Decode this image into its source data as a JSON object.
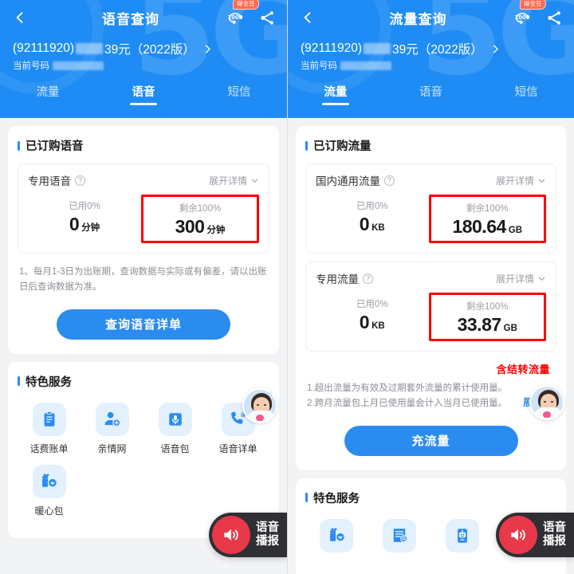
{
  "screens": [
    {
      "header": {
        "back_icon": "chevron-left-icon",
        "title": "语音查询",
        "coin_icon": "coin-1000-icon",
        "coin_badge": "得全豆",
        "share_icon": "share-icon",
        "watermark": "5G",
        "plan_id": "(92111920)",
        "plan_name": "39元（2022版）",
        "plan_chevron": "chevron-right-icon",
        "current_number_label": "当前号码",
        "tabs": [
          {
            "label": "流量",
            "active": false
          },
          {
            "label": "语音",
            "active": true
          },
          {
            "label": "短信",
            "active": false
          }
        ]
      },
      "subscribed": {
        "title": "已订购语音",
        "packages": [
          {
            "name": "专用语音",
            "help_icon": "question-circle-icon",
            "expand_label": "展开详情",
            "expand_icon": "chevron-down-icon",
            "used_label": "已用0%",
            "used_value": "0",
            "used_unit": "分钟",
            "left_label": "剩余100%",
            "left_value": "300",
            "left_unit": "分钟",
            "highlight": true
          }
        ],
        "notes": [
          "1、每月1-3日为出账期，查询数据与实际或有偏差，请以出账日后查询数据为准。"
        ],
        "cta": "查询语音详单"
      },
      "services": {
        "title": "特色服务",
        "items": [
          {
            "label": "话费账单",
            "icon": "clipboard-bill-icon"
          },
          {
            "label": "亲情网",
            "icon": "user-add-icon"
          },
          {
            "label": "语音包",
            "icon": "microphone-icon"
          },
          {
            "label": "语音详单",
            "icon": "phone-detail-icon"
          },
          {
            "label": "暖心包",
            "icon": "gift-heart-icon"
          }
        ]
      },
      "avatar": {
        "icon": "assistant-avatar"
      },
      "voice_fab": {
        "icon": "speaker-icon",
        "line1": "语音",
        "line2": "播报"
      }
    },
    {
      "header": {
        "back_icon": "chevron-left-icon",
        "title": "流量查询",
        "coin_icon": "coin-1000-icon",
        "coin_badge": "得全豆",
        "share_icon": "share-icon",
        "watermark": "5G",
        "plan_id": "(92111920)",
        "plan_name": "39元（2022版）",
        "plan_chevron": "chevron-right-icon",
        "current_number_label": "当前号码",
        "tabs": [
          {
            "label": "流量",
            "active": true
          },
          {
            "label": "语音",
            "active": false
          },
          {
            "label": "短信",
            "active": false
          }
        ]
      },
      "subscribed": {
        "title": "已订购流量",
        "packages": [
          {
            "name": "国内通用流量",
            "help_icon": "question-circle-icon",
            "expand_label": "展开详情",
            "expand_icon": "chevron-down-icon",
            "used_label": "已用0%",
            "used_value": "0",
            "used_unit": "KB",
            "left_label": "剩余100%",
            "left_value": "180.64",
            "left_unit": "GB",
            "highlight": true
          },
          {
            "name": "专用流量",
            "help_icon": "question-circle-icon",
            "expand_label": "展开详情",
            "expand_icon": "chevron-down-icon",
            "used_label": "已用0%",
            "used_value": "0",
            "used_unit": "KB",
            "left_label": "剩余100%",
            "left_value": "33.87",
            "left_unit": "GB",
            "highlight": true
          }
        ],
        "annotation": "含结转流量",
        "notes": [
          "1.超出流量为有效及过期套外流量的累计使用量。",
          "2.跨月流量包上月已使用量会计入当月已使用量。"
        ],
        "expand_label": "展开",
        "expand_icon": "chevron-down-icon",
        "cta": "充流量"
      },
      "services": {
        "title": "特色服务",
        "items": [
          {
            "label": "",
            "icon": "gift-heart-icon"
          },
          {
            "label": "",
            "icon": "doc-search-icon"
          },
          {
            "label": "",
            "icon": "phone-robot-icon"
          }
        ]
      },
      "avatar": {
        "icon": "assistant-avatar"
      },
      "voice_fab": {
        "icon": "speaker-icon",
        "line1": "语音",
        "line2": "播报"
      }
    }
  ],
  "colors": {
    "header_blue": "#1f8cf5",
    "accent_blue": "#2b8cf0",
    "annotation_red": "#ff0000",
    "fab_red": "#e8394a",
    "fab_dark": "#2e3033"
  }
}
